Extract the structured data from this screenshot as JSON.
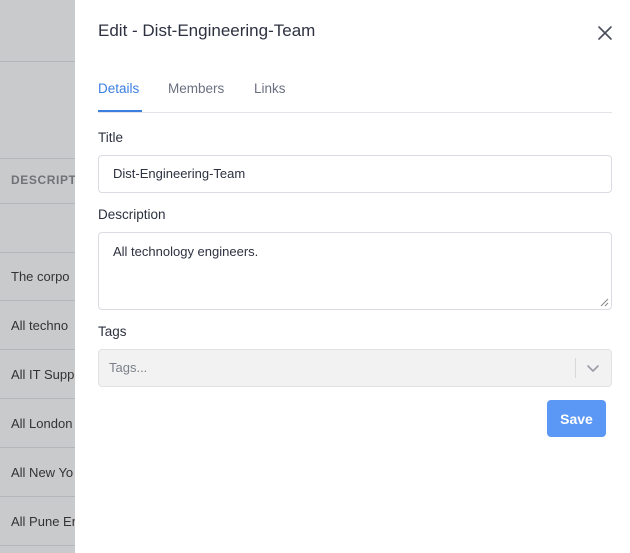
{
  "background": {
    "column_header": "DESCRIPT",
    "rows": [
      "The corpo",
      "All techno",
      "All IT Supp",
      "All London",
      "All New Yo",
      "All Pune En"
    ]
  },
  "drawer": {
    "title": "Edit - Dist-Engineering-Team",
    "tabs": [
      {
        "label": "Details",
        "active": true
      },
      {
        "label": "Members",
        "active": false
      },
      {
        "label": "Links",
        "active": false
      }
    ],
    "title_label": "Title",
    "title_value": "Dist-Engineering-Team",
    "description_label": "Description",
    "description_value": "All technology engineers.",
    "tags_label": "Tags",
    "tags_placeholder": "Tags...",
    "save_label": "Save"
  },
  "colors": {
    "accent": "#3d7fe0",
    "save_button": "#5b97f5",
    "overlay": "#9fa1a6"
  },
  "icons": {
    "close": "close-icon",
    "chevron": "chevron-down-icon",
    "resize": "resize-grip-icon"
  }
}
